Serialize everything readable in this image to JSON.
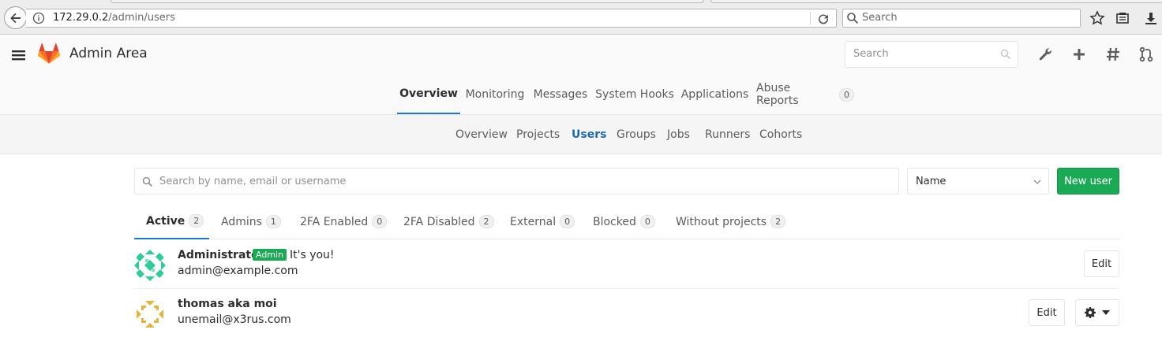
{
  "browser": {
    "url_host": "172.29.0.2",
    "url_path": "/admin/users",
    "search_placeholder": "Search"
  },
  "header": {
    "title": "Admin Area",
    "search_placeholder": "Search",
    "brand_color": "#fc6d26"
  },
  "top_nav": {
    "items": [
      {
        "label": "Overview",
        "active": true
      },
      {
        "label": "Monitoring"
      },
      {
        "label": "Messages"
      },
      {
        "label": "System Hooks"
      },
      {
        "label": "Applications"
      },
      {
        "label": "Abuse Reports",
        "count": "0"
      }
    ]
  },
  "sub_nav": {
    "items": [
      {
        "label": "Overview"
      },
      {
        "label": "Projects"
      },
      {
        "label": "Users",
        "active": true
      },
      {
        "label": "Groups"
      },
      {
        "label": "Jobs"
      },
      {
        "label": "Runners"
      },
      {
        "label": "Cohorts"
      }
    ]
  },
  "users_page": {
    "search_placeholder": "Search by name, email or username",
    "sort_value": "Name",
    "new_user_label": "New user",
    "filter_tabs": [
      {
        "label": "Active",
        "count": "2",
        "active": true
      },
      {
        "label": "Admins",
        "count": "1"
      },
      {
        "label": "2FA Enabled",
        "count": "0"
      },
      {
        "label": "2FA Disabled",
        "count": "2"
      },
      {
        "label": "External",
        "count": "0"
      },
      {
        "label": "Blocked",
        "count": "0"
      },
      {
        "label": "Without projects",
        "count": "2"
      }
    ],
    "users": [
      {
        "name": "Administrator",
        "badge": "Admin",
        "note": "It's you!",
        "email": "admin@example.com",
        "edit_label": "Edit"
      },
      {
        "name": "thomas aka moi",
        "email": "unemail@x3rus.com",
        "edit_label": "Edit"
      }
    ]
  }
}
